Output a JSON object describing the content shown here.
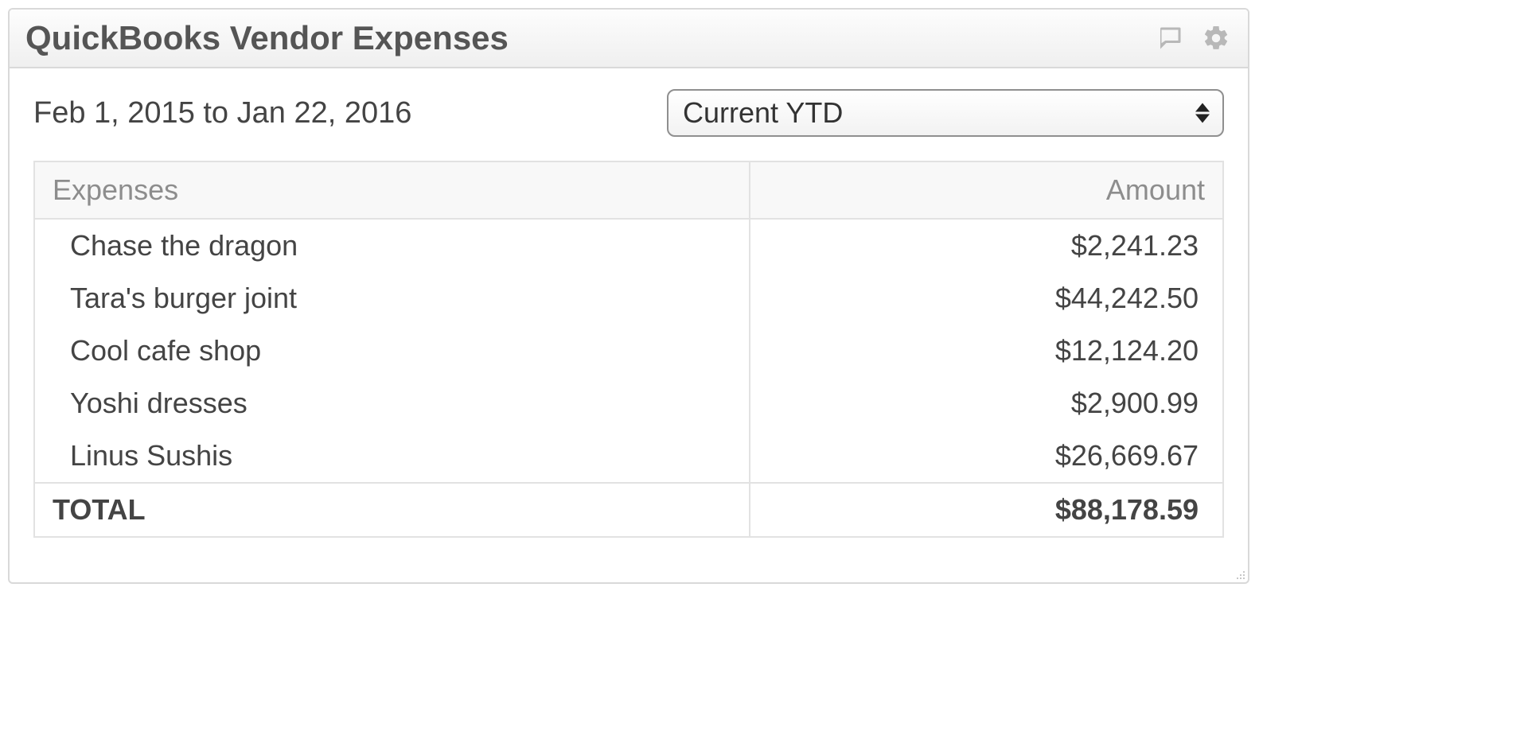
{
  "panel": {
    "title": "QuickBooks Vendor Expenses"
  },
  "controls": {
    "date_range": "Feb 1, 2015 to Jan 22, 2016",
    "period_selected": "Current YTD"
  },
  "table": {
    "headers": {
      "expenses": "Expenses",
      "amount": "Amount"
    },
    "rows": [
      {
        "name": "Chase the dragon",
        "amount": "$2,241.23"
      },
      {
        "name": "Tara's burger joint",
        "amount": "$44,242.50"
      },
      {
        "name": "Cool cafe shop",
        "amount": "$12,124.20"
      },
      {
        "name": "Yoshi dresses",
        "amount": "$2,900.99"
      },
      {
        "name": "Linus Sushis",
        "amount": "$26,669.67"
      }
    ],
    "total": {
      "label": "TOTAL",
      "amount": "$88,178.59"
    }
  },
  "chart_data": {
    "type": "table",
    "title": "QuickBooks Vendor Expenses",
    "period": "Current YTD",
    "date_range": "Feb 1, 2015 to Jan 22, 2016",
    "columns": [
      "Expenses",
      "Amount"
    ],
    "rows": [
      [
        "Chase the dragon",
        2241.23
      ],
      [
        "Tara's burger joint",
        44242.5
      ],
      [
        "Cool cafe shop",
        12124.2
      ],
      [
        "Yoshi dresses",
        2900.99
      ],
      [
        "Linus Sushis",
        26669.67
      ]
    ],
    "total": 88178.59,
    "currency": "USD"
  }
}
